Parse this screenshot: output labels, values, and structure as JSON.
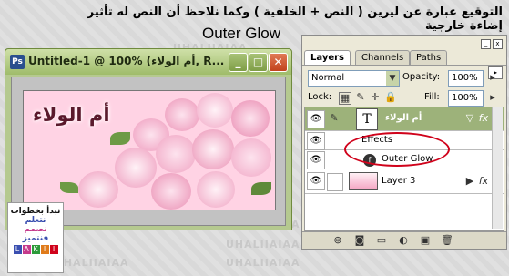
{
  "caption": {
    "arabic": "التوقيع عبارة عن ليرين ( النص + الخلفية ) وكما نلاحظ أن النص له تأثير إضاءة خارجية",
    "english": "Outer Glow"
  },
  "watermark": "UHALIIAIAA",
  "document": {
    "ps_icon": "Ps",
    "title": "Untitled-1 @ 100% (أم الولاء, R...",
    "minimize": "_",
    "maximize": "□",
    "close": "✕",
    "canvas_text": "أم الولاء",
    "colors": {
      "canvas_bg": "#ffd3e4",
      "rose": "#f3a6c4",
      "leaf": "#5f8a3a"
    }
  },
  "palette": {
    "tabs": [
      "Layers",
      "Channels",
      "Paths"
    ],
    "blend_mode": "Normal",
    "opacity_label": "Opacity:",
    "opacity_value": "100%",
    "lock_label": "Lock:",
    "fill_label": "Fill:",
    "fill_value": "100%",
    "layers": [
      {
        "name": "أم الولاء",
        "type": "text",
        "thumb": "T",
        "fx": "fx"
      },
      {
        "name": "Effects",
        "type": "effects-header"
      },
      {
        "name": "Outer Glow",
        "type": "effect"
      },
      {
        "name": "Layer 3",
        "type": "image",
        "fx": "fx"
      }
    ]
  },
  "logo": {
    "line1": "نبدأ بخطوات",
    "line2": "نتعلم",
    "line3": "نصمم",
    "line4": "فنتميز",
    "strip": [
      "L",
      "A",
      "K",
      "I",
      "I"
    ]
  }
}
